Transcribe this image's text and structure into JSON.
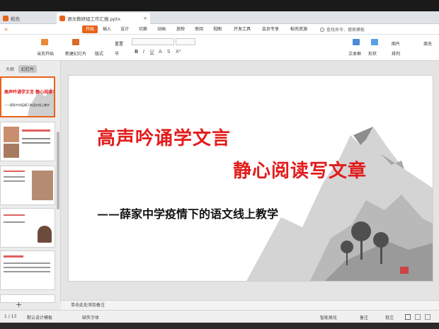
{
  "tabs": [
    {
      "label": "稻壳"
    },
    {
      "label": "语文教研组工作汇报.pptx"
    }
  ],
  "menu": [
    "开始",
    "插入",
    "设计",
    "切换",
    "动画",
    "放映",
    "审阅",
    "视图",
    "开发工具",
    "会员专享",
    "稻壳资源"
  ],
  "search_placeholder": "查找命令、搜索模板",
  "ribbon": {
    "from_current": "当页开始",
    "new_slide": "新建幻灯片",
    "layout": "版式",
    "section": "节",
    "reset": "重置",
    "textbox": "文本框",
    "shape": "形状",
    "arrange": "排列",
    "picture": "图片",
    "fill": "填充"
  },
  "panel_tabs": [
    "大纲",
    "幻灯片"
  ],
  "thumb1": {
    "title": "高声吟诵学文言 静心阅读写文章",
    "sub": "——薛家中学疫情下的语文线上教学"
  },
  "slide": {
    "title_line1": "高声吟诵学文言",
    "title_line2": "静心阅读写文章",
    "subtitle": "——薛家中学疫情下的语文线上教学"
  },
  "notes_placeholder": "单击此处添加备注",
  "status": {
    "page": "1 / 13",
    "theme": "默认设计模板",
    "font_missing": "缺失字体",
    "smart": "智能美化",
    "notes": "备注",
    "comments": "批注"
  },
  "colors": {
    "accent": "#e8631a",
    "title_red": "#e21c1c"
  }
}
